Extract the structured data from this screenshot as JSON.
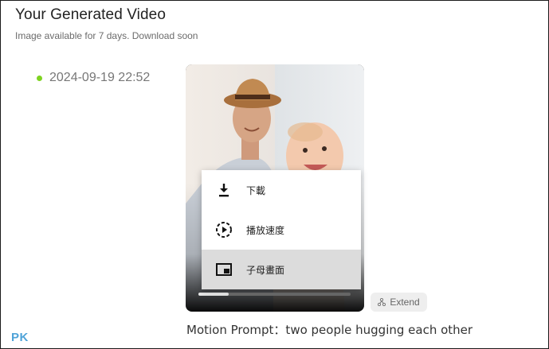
{
  "header": {
    "title": "Your Generated Video",
    "subtitle": "Image available for 7 days. Download soon"
  },
  "video": {
    "timestamp": "2024-09-19 22:52",
    "status_color": "#7ed321",
    "progress": 0.2
  },
  "context_menu": {
    "items": [
      {
        "label": "下載",
        "icon": "download-icon"
      },
      {
        "label": "播放速度",
        "icon": "playback-speed-icon"
      },
      {
        "label": "子母畫面",
        "icon": "picture-in-picture-icon"
      }
    ]
  },
  "actions": {
    "extend_label": "Extend"
  },
  "prompt": {
    "text": "Motion Prompt：two people hugging each other"
  },
  "watermark": {
    "text": "PK"
  }
}
